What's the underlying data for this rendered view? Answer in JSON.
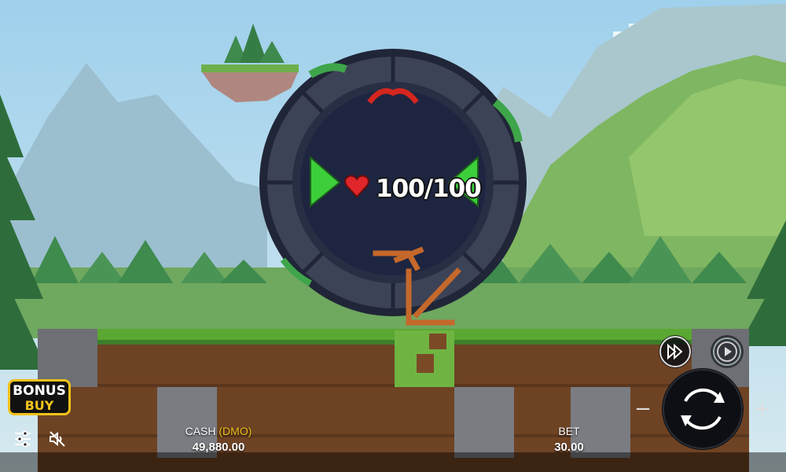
{
  "hp": {
    "current_max": "100/100",
    "fraction": 1.0
  },
  "bonus_buy": {
    "line1": "BONUS",
    "line2": "BUY"
  },
  "cash": {
    "label": "CASH",
    "mode": "(DMO)",
    "value": "49,880.00"
  },
  "bet": {
    "label": "BET",
    "value": "30.00",
    "minus": "−",
    "plus": "+"
  },
  "icons": {
    "settings": "sliders-icon",
    "sound": "sound-muted-icon",
    "turbo": "fast-forward-icon",
    "autoplay": "autoplay-icon",
    "spin": "spin-icon",
    "heart": "heart-icon"
  },
  "colors": {
    "accent": "#f2c21b",
    "grass": "#5aa832",
    "dirt": "#7a4a26",
    "portal_ring": "#3c4356",
    "portal_inner": "#1d2540"
  }
}
